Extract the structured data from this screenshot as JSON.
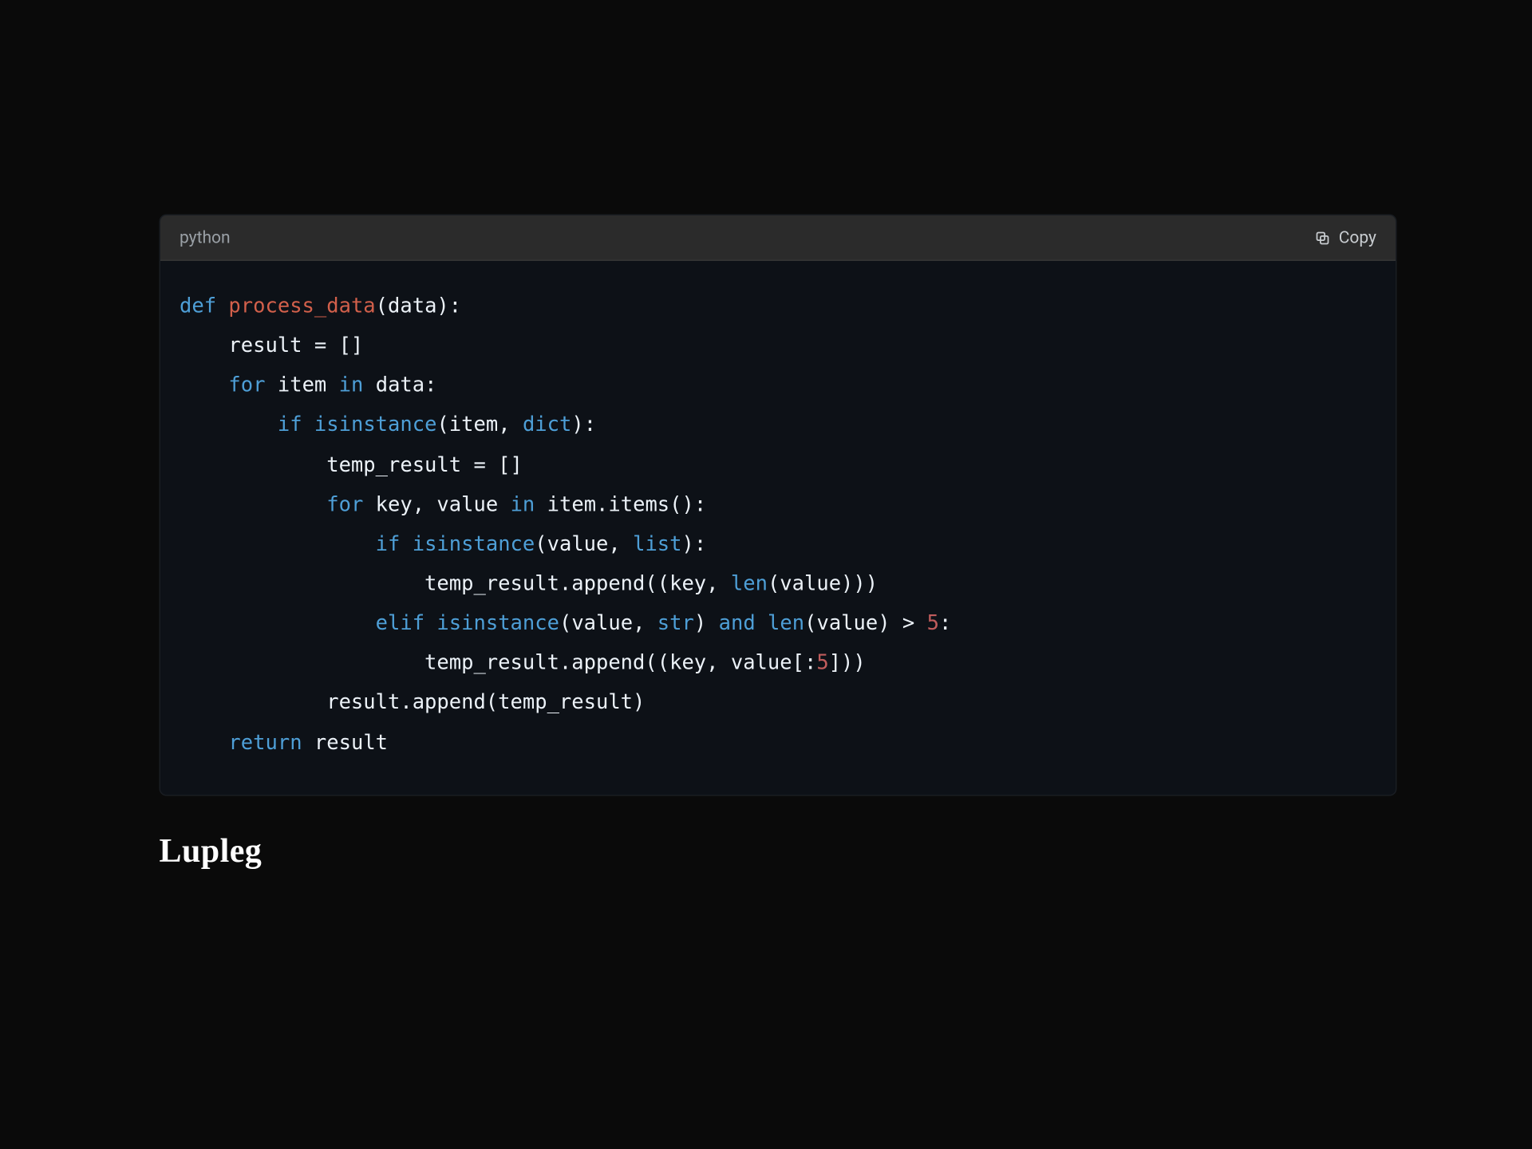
{
  "codeBlock": {
    "language": "python",
    "copyLabel": "Copy",
    "lines": [
      [
        {
          "t": "def ",
          "c": "kw"
        },
        {
          "t": "process_data",
          "c": "fn"
        },
        {
          "t": "(data):",
          "c": "id"
        }
      ],
      [
        {
          "t": "    result = []",
          "c": "id"
        }
      ],
      [
        {
          "t": "    ",
          "c": "id"
        },
        {
          "t": "for ",
          "c": "kw"
        },
        {
          "t": "item ",
          "c": "id"
        },
        {
          "t": "in ",
          "c": "kw"
        },
        {
          "t": "data:",
          "c": "id"
        }
      ],
      [
        {
          "t": "        ",
          "c": "id"
        },
        {
          "t": "if ",
          "c": "kw"
        },
        {
          "t": "isinstance",
          "c": "bi"
        },
        {
          "t": "(item, ",
          "c": "id"
        },
        {
          "t": "dict",
          "c": "bi"
        },
        {
          "t": "):",
          "c": "id"
        }
      ],
      [
        {
          "t": "            temp_result = []",
          "c": "id"
        }
      ],
      [
        {
          "t": "            ",
          "c": "id"
        },
        {
          "t": "for ",
          "c": "kw"
        },
        {
          "t": "key, value ",
          "c": "id"
        },
        {
          "t": "in ",
          "c": "kw"
        },
        {
          "t": "item.items():",
          "c": "id"
        }
      ],
      [
        {
          "t": "                ",
          "c": "id"
        },
        {
          "t": "if ",
          "c": "kw"
        },
        {
          "t": "isinstance",
          "c": "bi"
        },
        {
          "t": "(value, ",
          "c": "id"
        },
        {
          "t": "list",
          "c": "bi"
        },
        {
          "t": "):",
          "c": "id"
        }
      ],
      [
        {
          "t": "                    temp_result.append((key, ",
          "c": "id"
        },
        {
          "t": "len",
          "c": "bi"
        },
        {
          "t": "(value)))",
          "c": "id"
        }
      ],
      [
        {
          "t": "                ",
          "c": "id"
        },
        {
          "t": "elif ",
          "c": "kw"
        },
        {
          "t": "isinstance",
          "c": "bi"
        },
        {
          "t": "(value, ",
          "c": "id"
        },
        {
          "t": "str",
          "c": "bi"
        },
        {
          "t": ") ",
          "c": "id"
        },
        {
          "t": "and ",
          "c": "kw"
        },
        {
          "t": "len",
          "c": "bi"
        },
        {
          "t": "(value) > ",
          "c": "id"
        },
        {
          "t": "5",
          "c": "num"
        },
        {
          "t": ":",
          "c": "id"
        }
      ],
      [
        {
          "t": "                    temp_result.append((key, value[:",
          "c": "id"
        },
        {
          "t": "5",
          "c": "num"
        },
        {
          "t": "]))",
          "c": "id"
        }
      ],
      [
        {
          "t": "            result.append(temp_result)",
          "c": "id"
        }
      ],
      [
        {
          "t": "    ",
          "c": "id"
        },
        {
          "t": "return ",
          "c": "kw"
        },
        {
          "t": "result",
          "c": "id"
        }
      ]
    ]
  },
  "caption": "Lupleg"
}
